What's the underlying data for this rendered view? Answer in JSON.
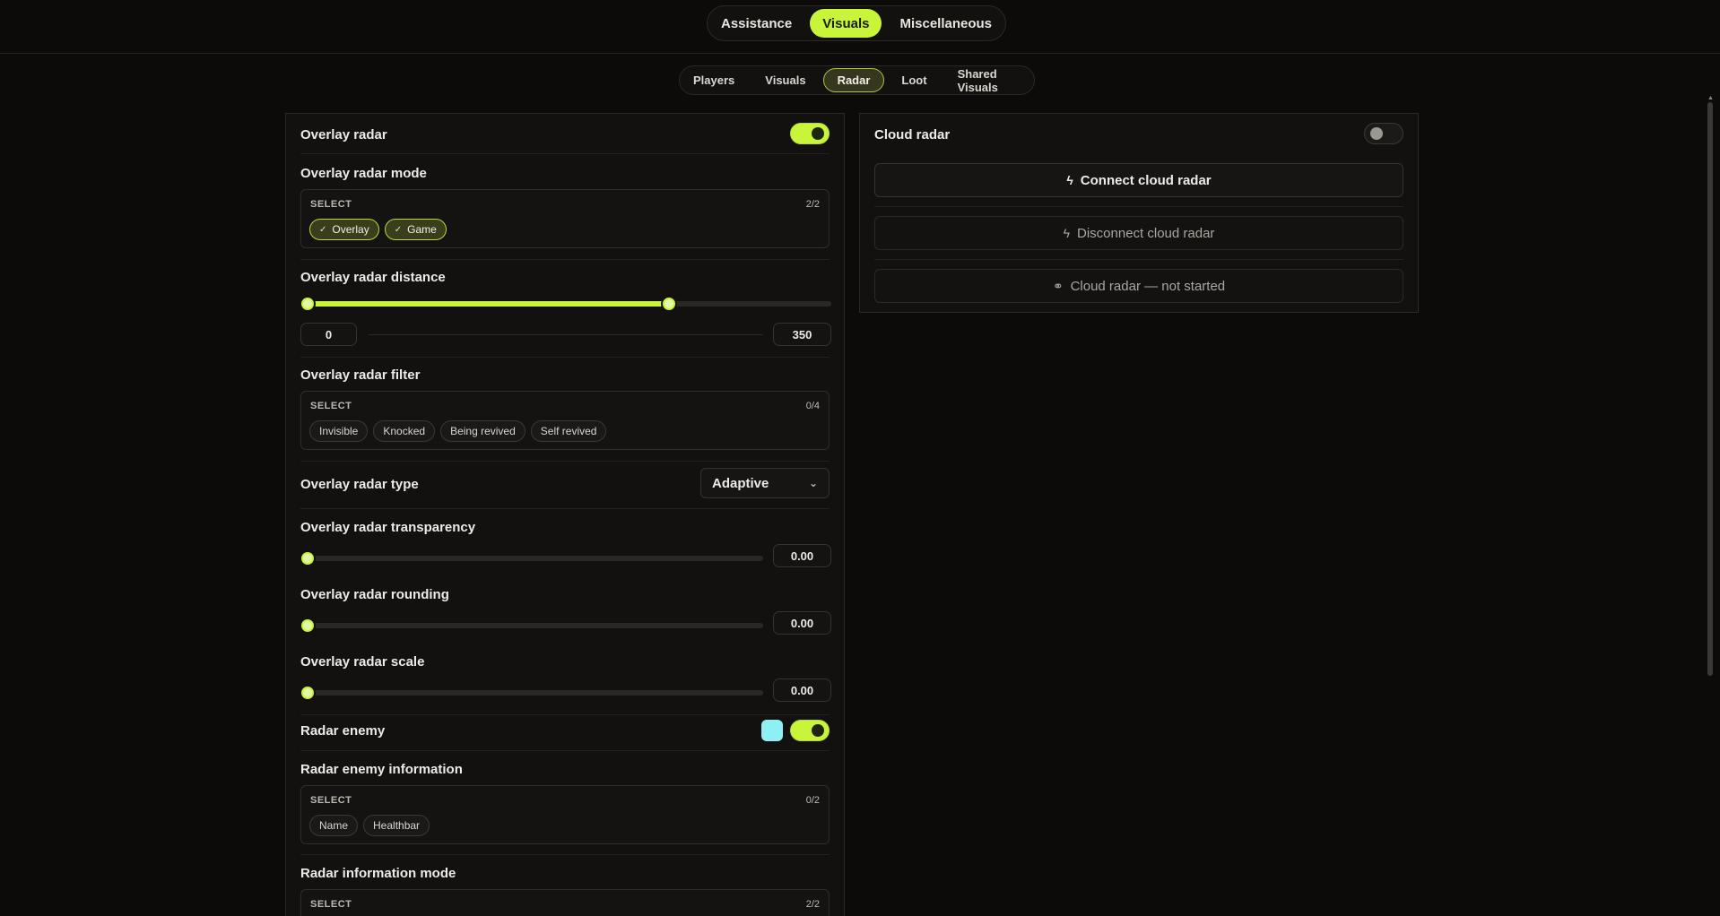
{
  "top_nav": {
    "tabs": [
      "Assistance",
      "Visuals",
      "Miscellaneous"
    ],
    "active": "Visuals"
  },
  "sub_nav": {
    "tabs": [
      "Players",
      "Visuals",
      "Radar",
      "Loot",
      "Shared Visuals"
    ],
    "active": "Radar"
  },
  "accent_color": "#c8f53a",
  "left_panel": {
    "overlay_radar": {
      "label": "Overlay radar",
      "enabled": true
    },
    "overlay_radar_mode": {
      "label": "Overlay radar mode",
      "select_label": "SELECT",
      "count": "2/2",
      "chips": [
        {
          "text": "Overlay",
          "selected": true
        },
        {
          "text": "Game",
          "selected": true
        }
      ]
    },
    "overlay_radar_distance": {
      "label": "Overlay radar distance",
      "min_value": "0",
      "max_value": "350",
      "range_fraction": [
        0,
        0.69
      ]
    },
    "overlay_radar_filter": {
      "label": "Overlay radar filter",
      "select_label": "SELECT",
      "count": "0/4",
      "chips": [
        {
          "text": "Invisible"
        },
        {
          "text": "Knocked"
        },
        {
          "text": "Being revived"
        },
        {
          "text": "Self revived"
        }
      ]
    },
    "overlay_radar_type": {
      "label": "Overlay radar type",
      "value": "Adaptive"
    },
    "overlay_radar_transparency": {
      "label": "Overlay radar transparency",
      "value": "0.00",
      "fraction": 0
    },
    "overlay_radar_rounding": {
      "label": "Overlay radar rounding",
      "value": "0.00",
      "fraction": 0
    },
    "overlay_radar_scale": {
      "label": "Overlay radar scale",
      "value": "0.00",
      "fraction": 0
    },
    "radar_enemy": {
      "label": "Radar enemy",
      "enabled": true,
      "color": "#8ef0f5"
    },
    "radar_enemy_information": {
      "label": "Radar enemy information",
      "select_label": "SELECT",
      "count": "0/2",
      "chips": [
        {
          "text": "Name"
        },
        {
          "text": "Healthbar"
        }
      ]
    },
    "radar_information_mode": {
      "label": "Radar information mode",
      "select_label": "SELECT",
      "count": "2/2"
    }
  },
  "right_panel": {
    "cloud_radar": {
      "label": "Cloud radar",
      "enabled": false
    },
    "connect_button": {
      "label": "Connect cloud radar",
      "icon": "bolt-icon"
    },
    "disconnect_button": {
      "label": "Disconnect cloud radar",
      "icon": "bolt-icon"
    },
    "status_button": {
      "label": "Cloud radar — not started",
      "icon": "link-icon"
    }
  }
}
